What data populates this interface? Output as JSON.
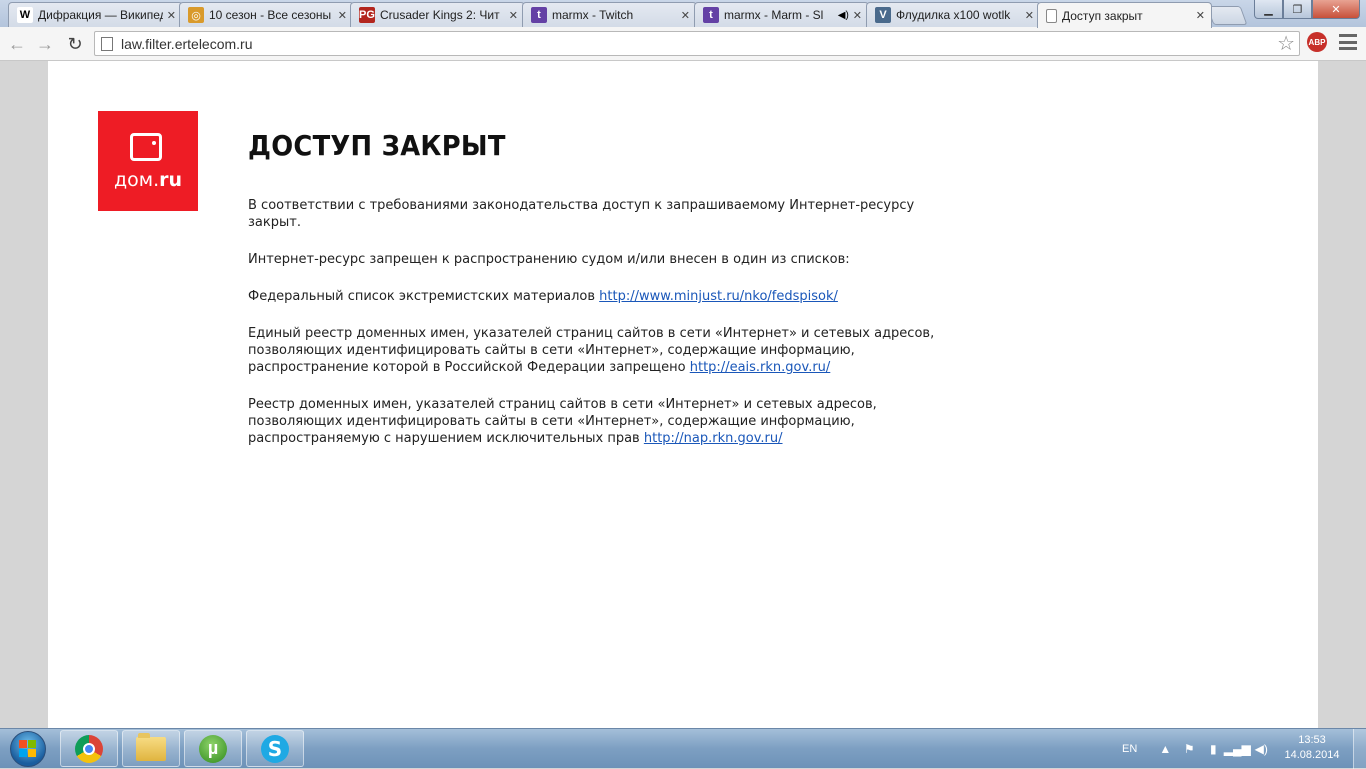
{
  "browser": {
    "tabs": [
      {
        "title": "Дифракция — Википедия",
        "icon_text": "W",
        "icon_bg": "#ffffff",
        "icon_color": "#000000",
        "active": false
      },
      {
        "title": "10 сезон - Все сезоны",
        "icon_text": "◎",
        "icon_bg": "#d99a2b",
        "icon_color": "#ffffff",
        "active": false
      },
      {
        "title": "Crusader Kings 2: Чит",
        "icon_text": "PG",
        "icon_bg": "#b3261e",
        "icon_color": "#ffffff",
        "active": false
      },
      {
        "title": "marmx - Twitch",
        "icon_text": "t",
        "icon_bg": "#6441a5",
        "icon_color": "#ffffff",
        "active": false
      },
      {
        "title": "marmx - Marm - Sl",
        "icon_text": "t",
        "icon_bg": "#6441a5",
        "icon_color": "#ffffff",
        "active": false,
        "audio": "◀)"
      },
      {
        "title": "Флудилка х100 wotlk",
        "icon_text": "V",
        "icon_bg": "#4a6a8c",
        "icon_color": "#ffffff",
        "active": false
      },
      {
        "title": "Доступ закрыт",
        "icon_text": "",
        "icon_bg": "#ffffff",
        "icon_color": "#000000",
        "active": true
      }
    ],
    "close_glyph": "✕",
    "address": "law.filter.ertelecom.ru",
    "abp_label": "ABP"
  },
  "page": {
    "logo": {
      "text_a": "дом.",
      "text_b": "ru"
    },
    "title": "ДОСТУП ЗАКРЫТ",
    "p1": "В соответствии с требованиями законодательства доступ к запрашиваемому Интернет-ресурсу закрыт.",
    "p2": "Интернет-ресурс запрещен к распространению судом и/или внесен в один из списков:",
    "p3_text": "Федеральный список экстремистских материалов ",
    "p3_link": "http://www.minjust.ru/nko/fedspisok/",
    "p4_text": "Единый реестр доменных имен, указателей страниц сайтов в сети «Интернет» и сетевых адресов, позволяющих идентифицировать сайты в сети «Интернет», содержащие информацию, распространение которой в Российской Федерации запрещено ",
    "p4_link": "http://eais.rkn.gov.ru/",
    "p5_text": "Реестр доменных имен, указателей страниц сайтов в сети «Интернет» и сетевых адресов, позволяющих идентифицировать сайты в сети «Интернет», содержащие информацию, распространяемую с нарушением исключительных прав ",
    "p5_link": "http://nap.rkn.gov.ru/"
  },
  "taskbar": {
    "language": "EN",
    "time": "13:53",
    "date": "14.08.2014",
    "skype_letter": "S",
    "utorrent_letter": "µ"
  },
  "colors": {
    "logo_red": "#ee1c25",
    "link": "#1a57b9"
  }
}
